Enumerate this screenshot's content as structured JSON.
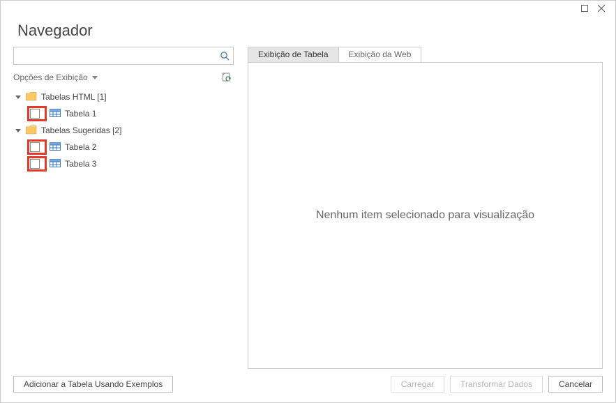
{
  "window": {
    "title": "Navegador"
  },
  "search": {
    "placeholder": ""
  },
  "options": {
    "label": "Opções de Exibição"
  },
  "tree": {
    "groups": [
      {
        "label": "Tabelas HTML [1]",
        "items": [
          {
            "label": "Tabela 1"
          }
        ]
      },
      {
        "label": "Tabelas Sugeridas [2]",
        "items": [
          {
            "label": "Tabela 2"
          },
          {
            "label": "Tabela 3"
          }
        ]
      }
    ]
  },
  "tabs": {
    "table": "Exibição de Tabela",
    "web": "Exibição da Web"
  },
  "preview": {
    "empty": "Nenhum item selecionado para visualização"
  },
  "footer": {
    "add_examples": "Adicionar a Tabela Usando Exemplos",
    "load": "Carregar",
    "transform": "Transformar Dados",
    "cancel": "Cancelar"
  }
}
